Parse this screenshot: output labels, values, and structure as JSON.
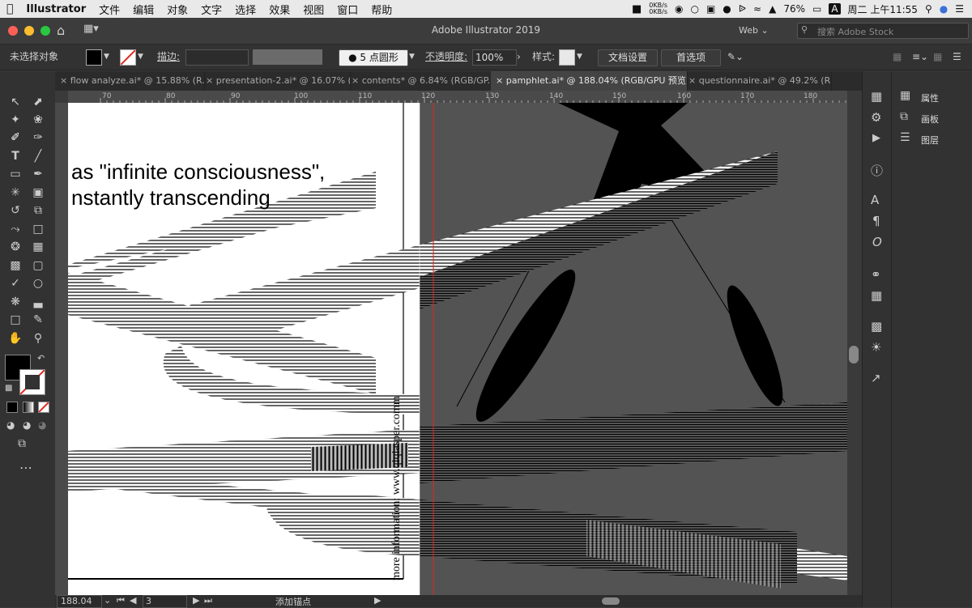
{
  "menubar": {
    "app_name": "Illustrator",
    "items": [
      "文件",
      "编辑",
      "对象",
      "文字",
      "选择",
      "效果",
      "视图",
      "窗口",
      "帮助"
    ],
    "net_up": "0KB/s",
    "net_down": "0KB/s",
    "battery": "76%",
    "clock": "周二 上午11:55"
  },
  "window": {
    "title": "Adobe Illustrator 2019",
    "workspace": "Web",
    "search_placeholder": "搜索 Adobe Stock"
  },
  "control": {
    "selection_label": "未选择对象",
    "stroke_label": "描边:",
    "brush_label": "5 点圆形",
    "opacity_label": "不透明度:",
    "opacity_value": "100%",
    "style_label": "样式:",
    "doc_setup_button": "文档设置",
    "prefs_button": "首选项"
  },
  "tabs": [
    {
      "label": "flow analyze.ai* @ 15.88% (R..."
    },
    {
      "label": "presentation-2.ai* @ 16.07% (..."
    },
    {
      "label": "contents* @ 6.84% (RGB/GP..."
    },
    {
      "label": "pamphlet.ai* @ 188.04% (RGB/GPU 预览)"
    },
    {
      "label": "questionnaire.ai* @ 49.2% (R..."
    }
  ],
  "ruler": {
    "h_ticks": [
      "70",
      "80",
      "90",
      "100",
      "110",
      "120",
      "130",
      "140",
      "150",
      "160",
      "170",
      "180"
    ]
  },
  "artboard": {
    "line1": "as \"infinite consciousness\",",
    "line2": "nstantly transcending",
    "vertical_text": "more information: www.qiqiasper.comm"
  },
  "panel": {
    "items": [
      "属性",
      "画板",
      "图层"
    ]
  },
  "status": {
    "zoom": "188.04",
    "page": "3",
    "mode": "添加锚点"
  },
  "colors": {
    "accent_blue": "#2b6fd6",
    "canvas_grey": "#535353",
    "guide_red": "#e0281e"
  }
}
